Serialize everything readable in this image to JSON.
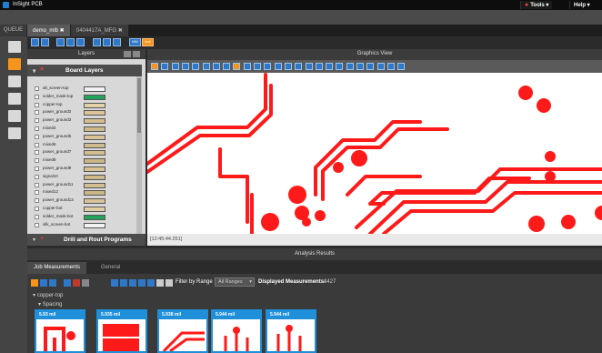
{
  "app": {
    "title": "InSight PCB",
    "menus": [
      "Tools ▾",
      "Help ▾"
    ]
  },
  "tabs": [
    {
      "label": "QUEUE",
      "active": false
    },
    {
      "label": "demo_mlb ✖",
      "active": true
    },
    {
      "label": "0404417A_MFG ✖",
      "active": false
    }
  ],
  "toolbar_badges": [
    "MM",
    "Inch"
  ],
  "layers_panel": {
    "title": "Layers",
    "section": "Board Layers",
    "layers": [
      {
        "name": "alt_screen-top",
        "color": "#f2f2f2"
      },
      {
        "name": "solder_mask-top",
        "color": "#22a35a"
      },
      {
        "name": "copper-top",
        "color": "#e2d0a6"
      },
      {
        "name": "power_ground2",
        "color": "#dcc497"
      },
      {
        "name": "power_ground3",
        "color": "#d7be8c"
      },
      {
        "name": "mixed4",
        "color": "#cdb889"
      },
      {
        "name": "power_ground5",
        "color": "#d8c296"
      },
      {
        "name": "mixed6",
        "color": "#cfbb8d"
      },
      {
        "name": "power_ground7",
        "color": "#d4be8f"
      },
      {
        "name": "mixed8",
        "color": "#cab585"
      },
      {
        "name": "power_ground9",
        "color": "#d7c296"
      },
      {
        "name": "signal10",
        "color": "#cdb889"
      },
      {
        "name": "power_ground11",
        "color": "#d4bf93"
      },
      {
        "name": "mixed12",
        "color": "#cbb686"
      },
      {
        "name": "power_ground13",
        "color": "#d8c398"
      },
      {
        "name": "copper-bot",
        "color": "#e0cfa4"
      },
      {
        "name": "solder_mask-bot",
        "color": "#22a35a"
      },
      {
        "name": "silk_screen-bot",
        "color": "#f2f2f2"
      }
    ],
    "drill_section": "Drill and Rout Programs"
  },
  "graphics": {
    "title": "Graphics View",
    "status": "[12:45:44.251]"
  },
  "analysis": {
    "title": "Analysis Results",
    "tabs": [
      "Job Measurements",
      "General"
    ],
    "filter_label": "Filter by Range",
    "filter_value": "All Ranges",
    "displayed_label": "Displayed Measurements:",
    "displayed_count": "4427",
    "tree": [
      "copper-top",
      "Spacing"
    ],
    "cards": [
      "5.93 mil",
      "5.935 mil",
      "5.938 mil",
      "5.944 mil",
      "5.944 mil"
    ]
  },
  "colors": {
    "accent": "#1e8fd8",
    "trace": "#ff1a1a",
    "brand": "#2f78c8"
  }
}
